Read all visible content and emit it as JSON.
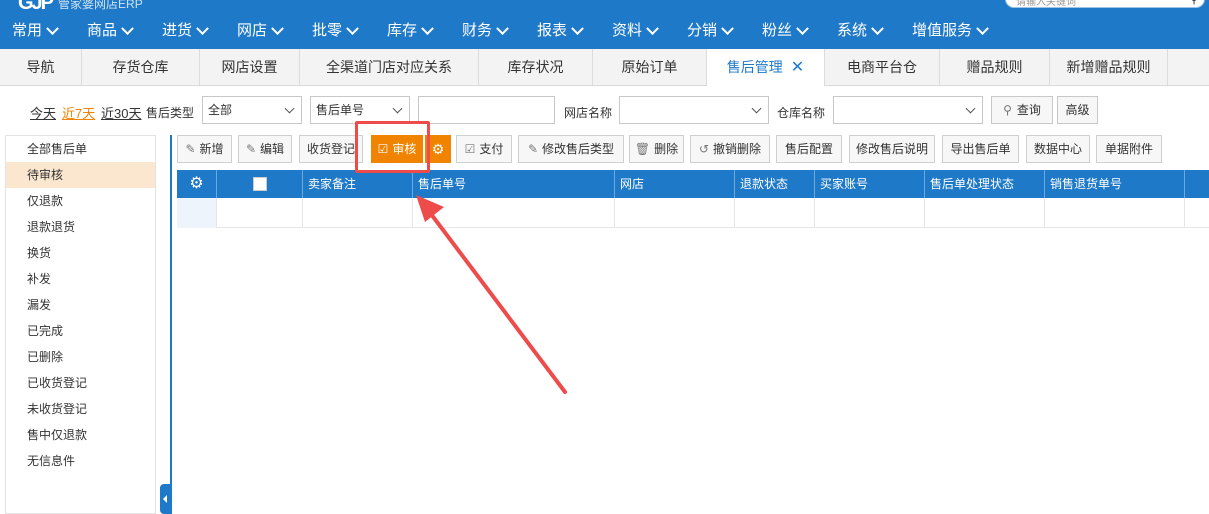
{
  "header": {
    "brand_text": "管家婆网店ERP",
    "search_placeholder": "请输入关键词",
    "menu": [
      {
        "label": "常用"
      },
      {
        "label": "商品"
      },
      {
        "label": "进货"
      },
      {
        "label": "网店"
      },
      {
        "label": "批零"
      },
      {
        "label": "库存"
      },
      {
        "label": "财务"
      },
      {
        "label": "报表"
      },
      {
        "label": "资料"
      },
      {
        "label": "分销"
      },
      {
        "label": "粉丝"
      },
      {
        "label": "系统"
      },
      {
        "label": "增值服务"
      }
    ]
  },
  "tabs": [
    {
      "label": "导航"
    },
    {
      "label": "存货仓库"
    },
    {
      "label": "网店设置"
    },
    {
      "label": "全渠道门店对应关系"
    },
    {
      "label": "库存状况"
    },
    {
      "label": "原始订单"
    },
    {
      "label": "售后管理",
      "active": true,
      "close": "✕"
    },
    {
      "label": "电商平台仓"
    },
    {
      "label": "赠品规则"
    },
    {
      "label": "新增赠品规则"
    }
  ],
  "filter": {
    "today": "今天",
    "last7": "近7天",
    "last30": "近30天",
    "after_sale_type_label": "售后类型",
    "after_sale_type_value": "全部",
    "order_field_value": "售后单号",
    "order_input_value": "",
    "shop_name_label": "网店名称",
    "shop_name_value": "",
    "warehouse_label": "仓库名称",
    "warehouse_value": "",
    "query_button": "查询",
    "advanced_button": "高级"
  },
  "sidebar": {
    "items": [
      {
        "label": "全部售后单"
      },
      {
        "label": "待审核",
        "active": true
      },
      {
        "label": "仅退款"
      },
      {
        "label": "退款退货"
      },
      {
        "label": "换货"
      },
      {
        "label": "补发"
      },
      {
        "label": "漏发"
      },
      {
        "label": "已完成"
      },
      {
        "label": "已删除"
      },
      {
        "label": "已收货登记"
      },
      {
        "label": "未收货登记"
      },
      {
        "label": "售中仅退款"
      },
      {
        "label": "无信息件"
      }
    ]
  },
  "toolbar": {
    "new": "新增",
    "edit": "编辑",
    "receive_register": "收货登记",
    "audit": "审核",
    "pay": "支付",
    "modify_type": "修改售后类型",
    "delete": "删除",
    "undo_delete": "撤销删除",
    "config": "售后配置",
    "modify_desc": "修改售后说明",
    "export": "导出售后单",
    "data_center": "数据中心",
    "attachments": "单据附件"
  },
  "table": {
    "columns": [
      "卖家备注",
      "售后单号",
      "网店",
      "退款状态",
      "买家账号",
      "售后单处理状态",
      "销售退货单号"
    ]
  },
  "colors": {
    "primary_blue": "#1f79c9",
    "accent_orange": "#f08300",
    "annotation_red": "#ee4b4b"
  }
}
